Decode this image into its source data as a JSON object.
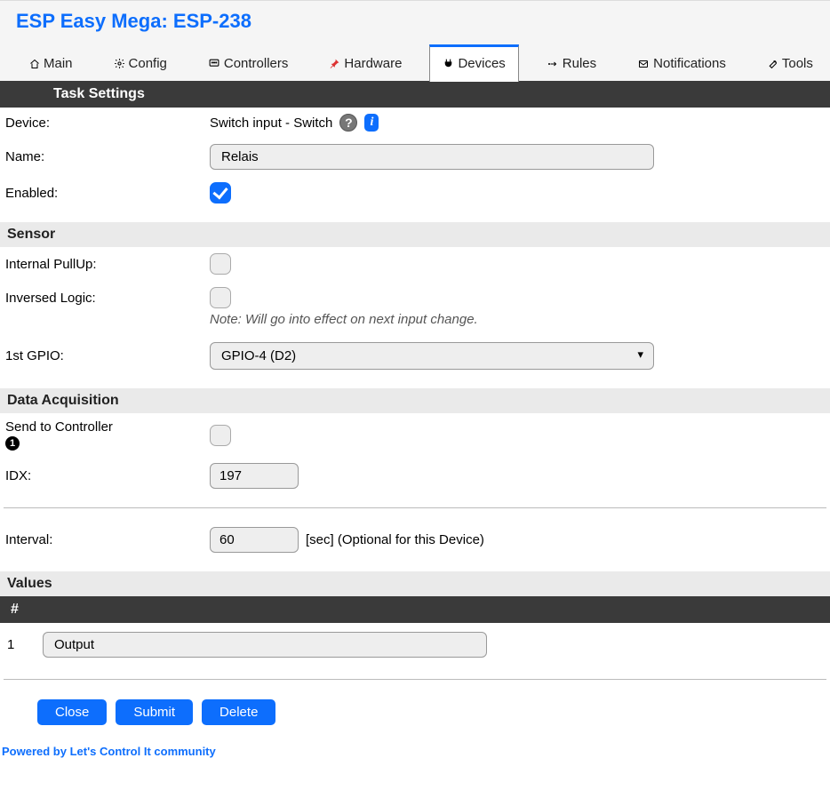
{
  "title": "ESP Easy Mega: ESP-238",
  "tabs": {
    "main": "Main",
    "config": "Config",
    "controllers": "Controllers",
    "hardware": "Hardware",
    "devices": "Devices",
    "rules": "Rules",
    "notifications": "Notifications",
    "tools": "Tools"
  },
  "sections": {
    "task_settings": "Task Settings",
    "sensor": "Sensor",
    "data_acq": "Data Acquisition",
    "values": "Values",
    "num_header": "#"
  },
  "labels": {
    "device": "Device:",
    "name": "Name:",
    "enabled": "Enabled:",
    "internal_pullup": "Internal PullUp:",
    "inversed_logic": "Inversed Logic:",
    "first_gpio": "1st GPIO:",
    "send_to_controller": "Send to Controller",
    "idx": "IDX:",
    "interval": "Interval:",
    "interval_suffix": "[sec] (Optional for this Device)"
  },
  "device_type": "Switch input - Switch",
  "note": "Note: Will go into effect on next input change.",
  "fields": {
    "name": "Relais",
    "enabled": true,
    "internal_pullup": false,
    "inversed_logic": false,
    "gpio": "GPIO-4 (D2)",
    "send_to_controller": false,
    "idx": "197",
    "interval": "60"
  },
  "controller_num": "1",
  "values_rows": [
    {
      "num": "1",
      "name": "Output"
    }
  ],
  "buttons": {
    "close": "Close",
    "submit": "Submit",
    "delete": "Delete"
  },
  "footer": {
    "prefix": "Powered by ",
    "link": "Let's Control It",
    "suffix": " community"
  }
}
